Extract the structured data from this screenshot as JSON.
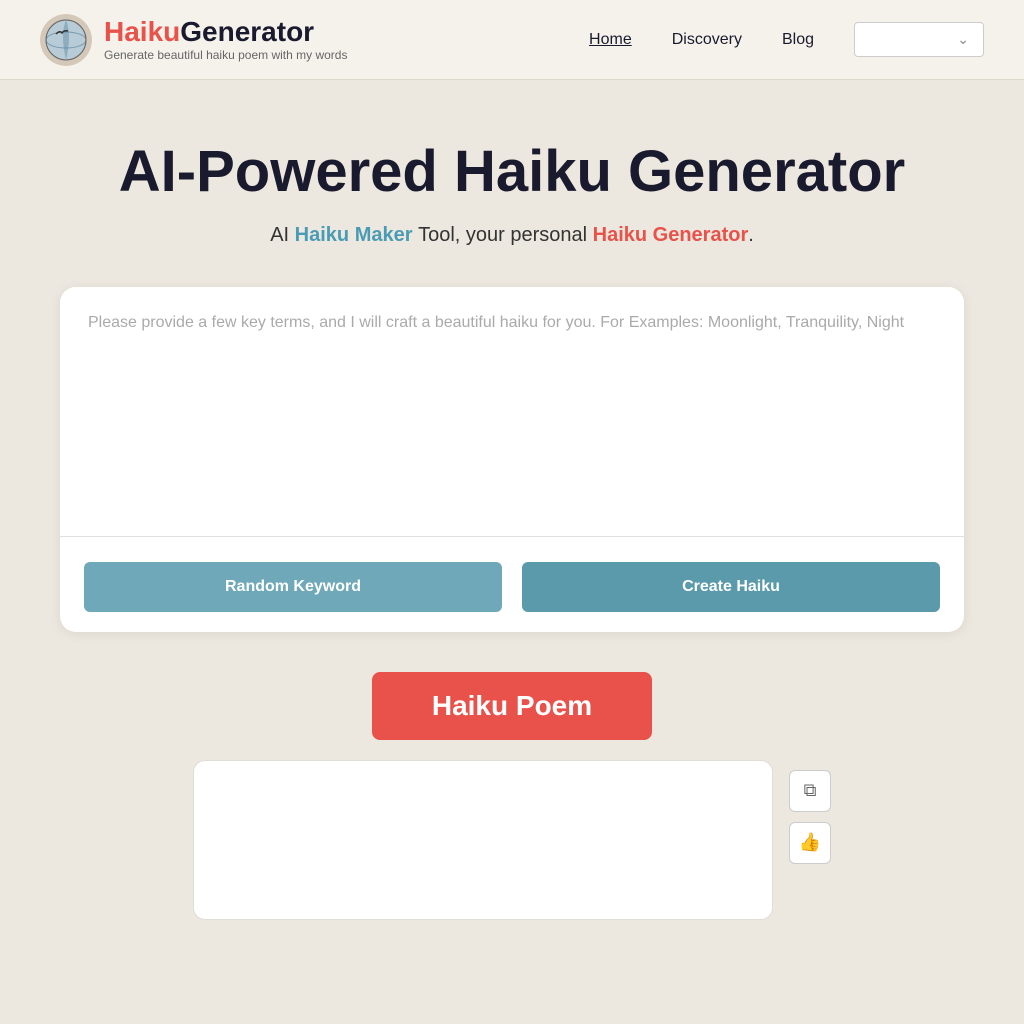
{
  "header": {
    "logo": {
      "haiku_text": "Haiku",
      "generator_text": "Generator",
      "subtitle": "Generate beautiful haiku poem with my words"
    },
    "nav": {
      "home_label": "Home",
      "discovery_label": "Discovery",
      "blog_label": "Blog",
      "dropdown_placeholder": ""
    }
  },
  "hero": {
    "title": "AI-Powered Haiku Generator",
    "subtitle_prefix": "AI",
    "haiku_maker_label": "Haiku Maker",
    "subtitle_middle": "Tool, your personal",
    "haiku_generator_label": "Haiku Generator",
    "subtitle_suffix": "."
  },
  "input_area": {
    "placeholder": "Please provide a few key terms, and I will craft a beautiful haiku for you. For Examples: Moonlight, Tranquility, Night",
    "random_button_label": "Random Keyword",
    "create_button_label": "Create Haiku"
  },
  "output": {
    "badge_label": "Haiku Poem",
    "copy_icon": "⧉",
    "like_icon": "👍"
  }
}
